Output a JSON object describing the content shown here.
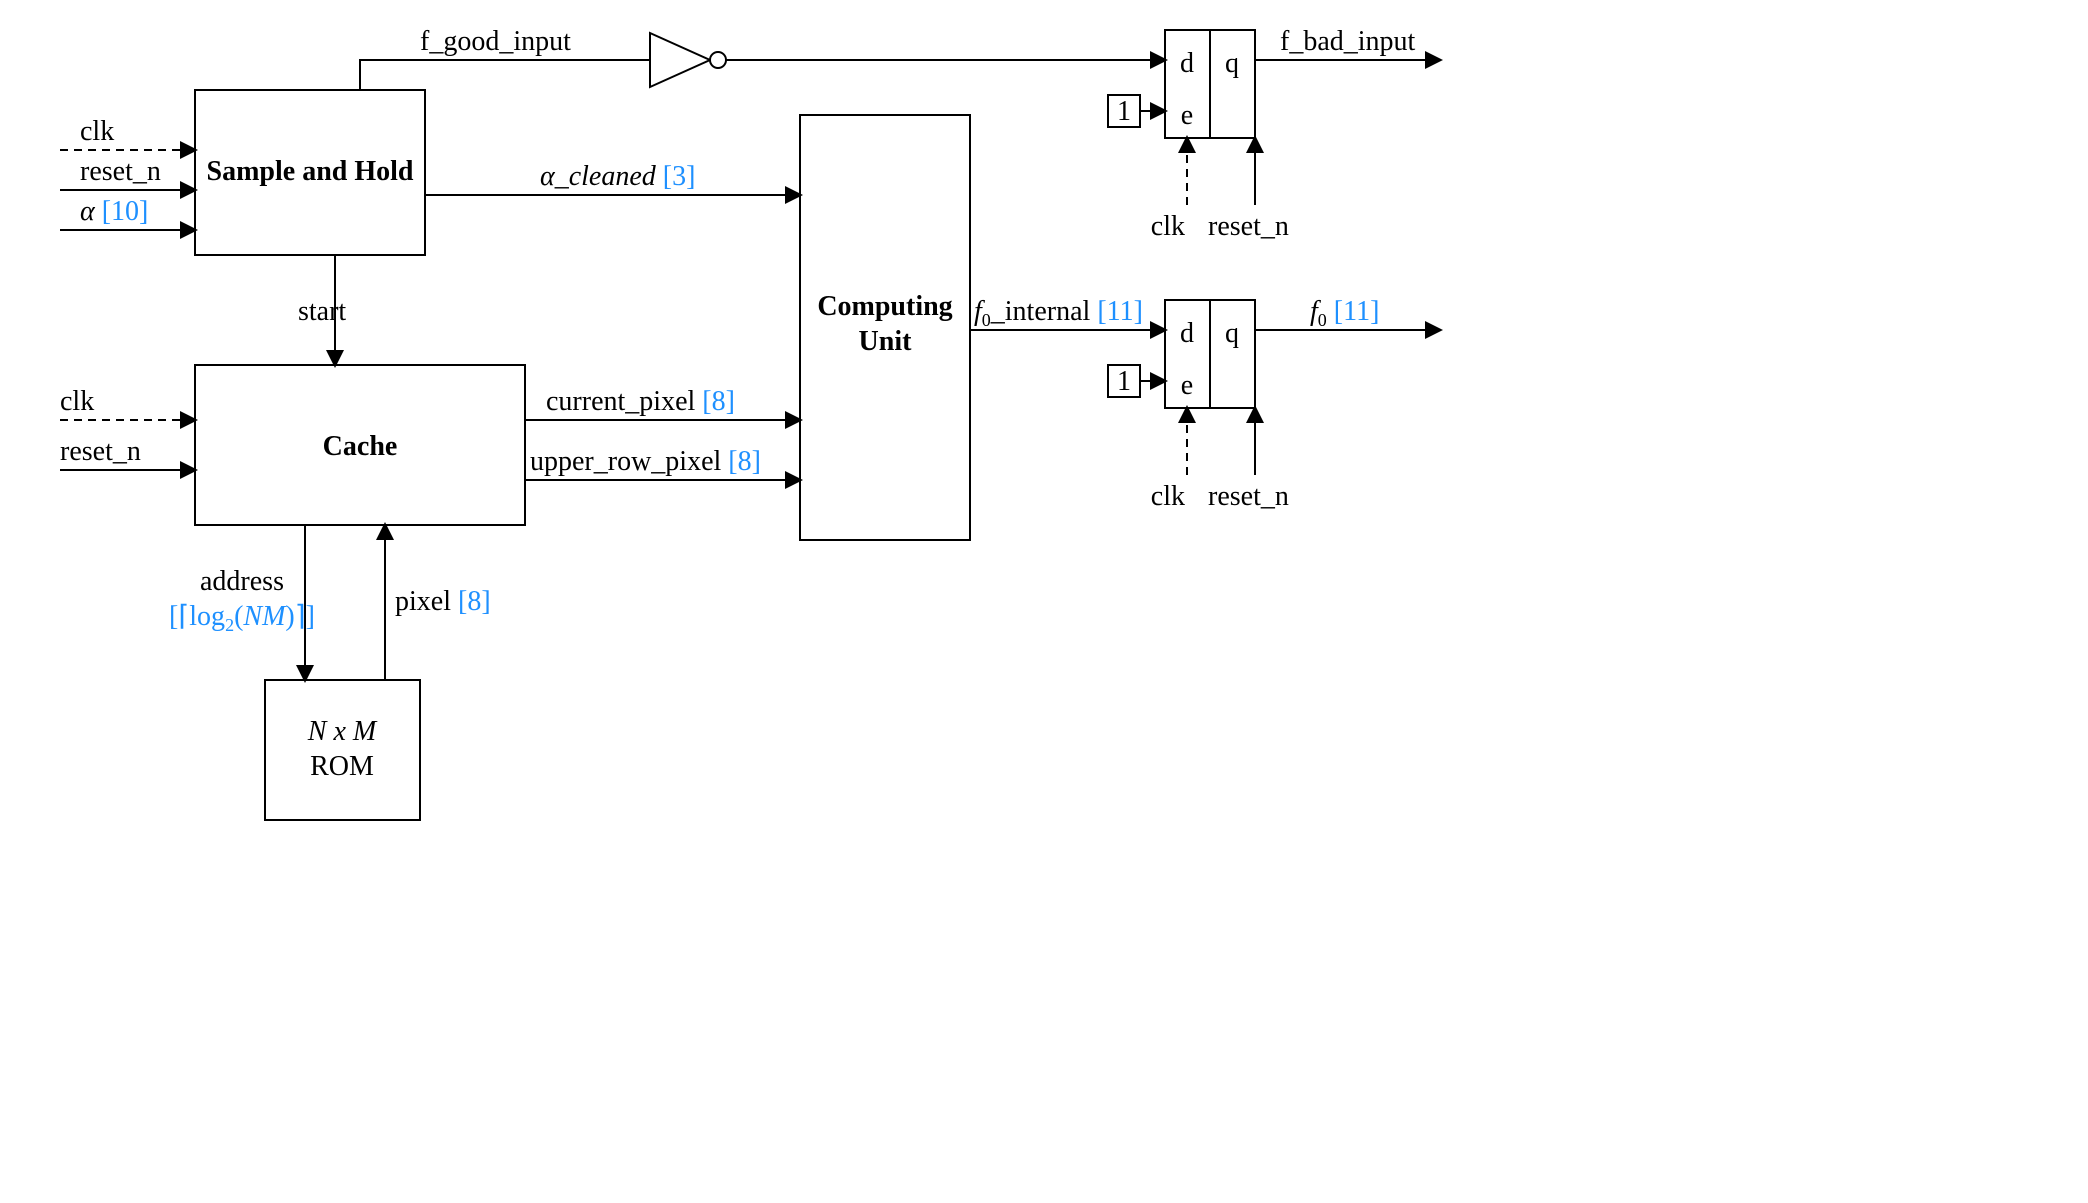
{
  "blocks": {
    "sample_hold": "Sample and Hold",
    "cache": "Cache",
    "computing_unit_l1": "Computing",
    "computing_unit_l2": "Unit",
    "rom_l1": "N x M",
    "rom_l2": "ROM"
  },
  "signals": {
    "clk": "clk",
    "reset_n": "reset_n",
    "alpha": "α ",
    "alpha_bits": "[10]",
    "f_good_input": "f_good_input",
    "f_bad_input": "f_bad_input",
    "alpha_cleaned": "α_cleaned ",
    "alpha_cleaned_bits": "[3]",
    "start": "start",
    "current_pixel": "current_pixel ",
    "current_pixel_bits": "[8]",
    "upper_row_pixel": "upper_row_pixel ",
    "upper_row_pixel_bits": "[8]",
    "address": "address",
    "address_bits": "[⌈log₂(NM)⌉]",
    "pixel": "pixel ",
    "pixel_bits": "[8]",
    "f0_internal": "_internal ",
    "f0_internal_bits": "[11]",
    "f0letter": "f",
    "f0_bits": "[11]",
    "one": "1"
  },
  "ff": {
    "d": "d",
    "q": "q",
    "e": "e"
  }
}
